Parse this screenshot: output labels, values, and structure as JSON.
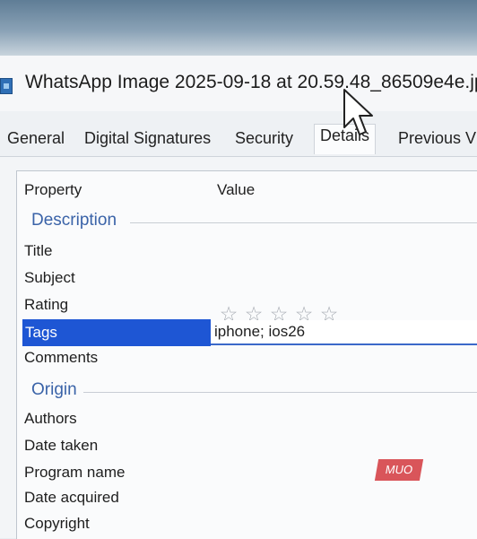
{
  "window": {
    "title": "WhatsApp Image 2025-09-18 at 20.59.48_86509e4e.jp"
  },
  "tabs": [
    {
      "label": "General"
    },
    {
      "label": "Digital Signatures"
    },
    {
      "label": "Security"
    },
    {
      "label": "Details"
    },
    {
      "label": "Previous V"
    }
  ],
  "details": {
    "col_property": "Property",
    "col_value": "Value",
    "sections": [
      {
        "label": "Description"
      },
      {
        "label": "Origin"
      }
    ],
    "properties": [
      {
        "label": "Title"
      },
      {
        "label": "Subject"
      },
      {
        "label": "Rating"
      },
      {
        "label": "Tags"
      },
      {
        "label": "Comments"
      },
      {
        "label": "Authors"
      },
      {
        "label": "Date taken"
      },
      {
        "label": "Program name"
      },
      {
        "label": "Date acquired"
      },
      {
        "label": "Copyright"
      }
    ],
    "rating_value": 0,
    "rating_max": 5,
    "tags_value": "iphone; ios26"
  },
  "watermark": "MUO",
  "icons": {
    "file": "image-file-icon",
    "star": "star-icon",
    "cursor": "mouse-pointer-icon"
  }
}
